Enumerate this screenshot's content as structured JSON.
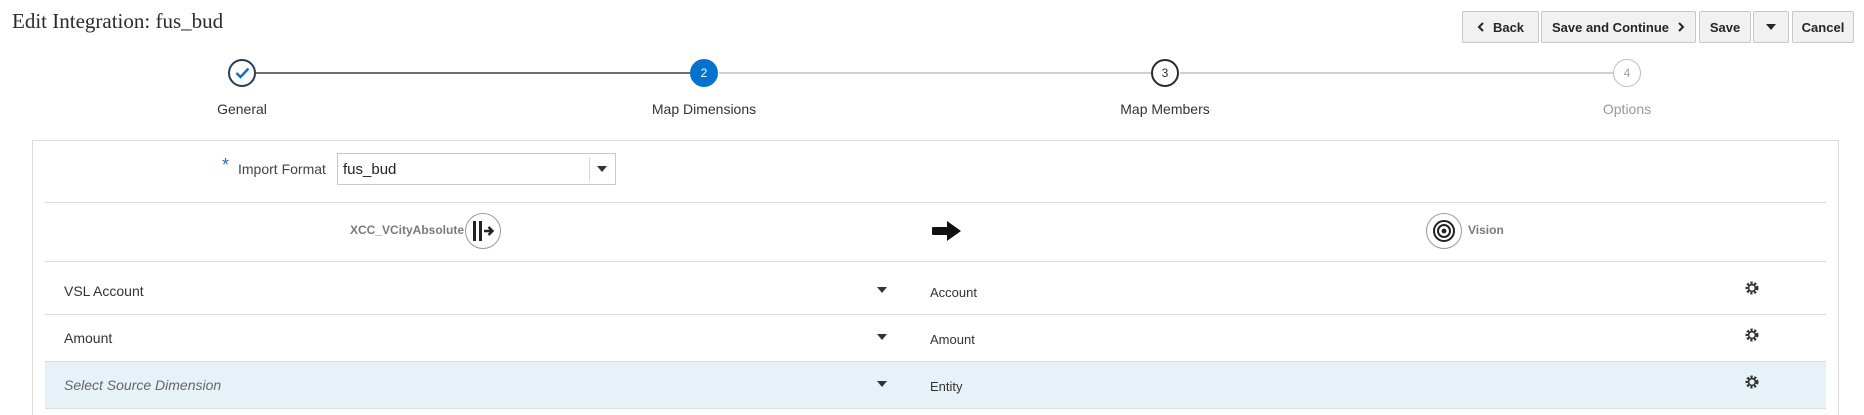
{
  "header": {
    "title": "Edit Integration: fus_bud"
  },
  "toolbar": {
    "back_label": "Back",
    "save_continue_label": "Save and Continue",
    "save_label": "Save",
    "cancel_label": "Cancel"
  },
  "train": {
    "steps": [
      {
        "label": "General",
        "state": "completed"
      },
      {
        "label": "Map Dimensions",
        "number": "2",
        "state": "current"
      },
      {
        "label": "Map Members",
        "number": "3",
        "state": "pending"
      },
      {
        "label": "Options",
        "number": "4",
        "state": "disabled"
      }
    ]
  },
  "import_format": {
    "required_mark": "*",
    "label": "Import Format",
    "value": "fus_bud"
  },
  "mapping_header": {
    "source_app": "XCC_VCityAbsolute",
    "target_app": "Vision"
  },
  "rows": [
    {
      "source": "VSL Account",
      "target": "Account",
      "selected": false
    },
    {
      "source": "Amount",
      "target": "Amount",
      "selected": false
    },
    {
      "source": "",
      "source_placeholder": "Select Source Dimension",
      "target": "Entity",
      "selected": true
    }
  ],
  "colors": {
    "accent": "#0572ce",
    "completed_ring": "#2b3d52",
    "row_selected": "#e7f2f8"
  }
}
